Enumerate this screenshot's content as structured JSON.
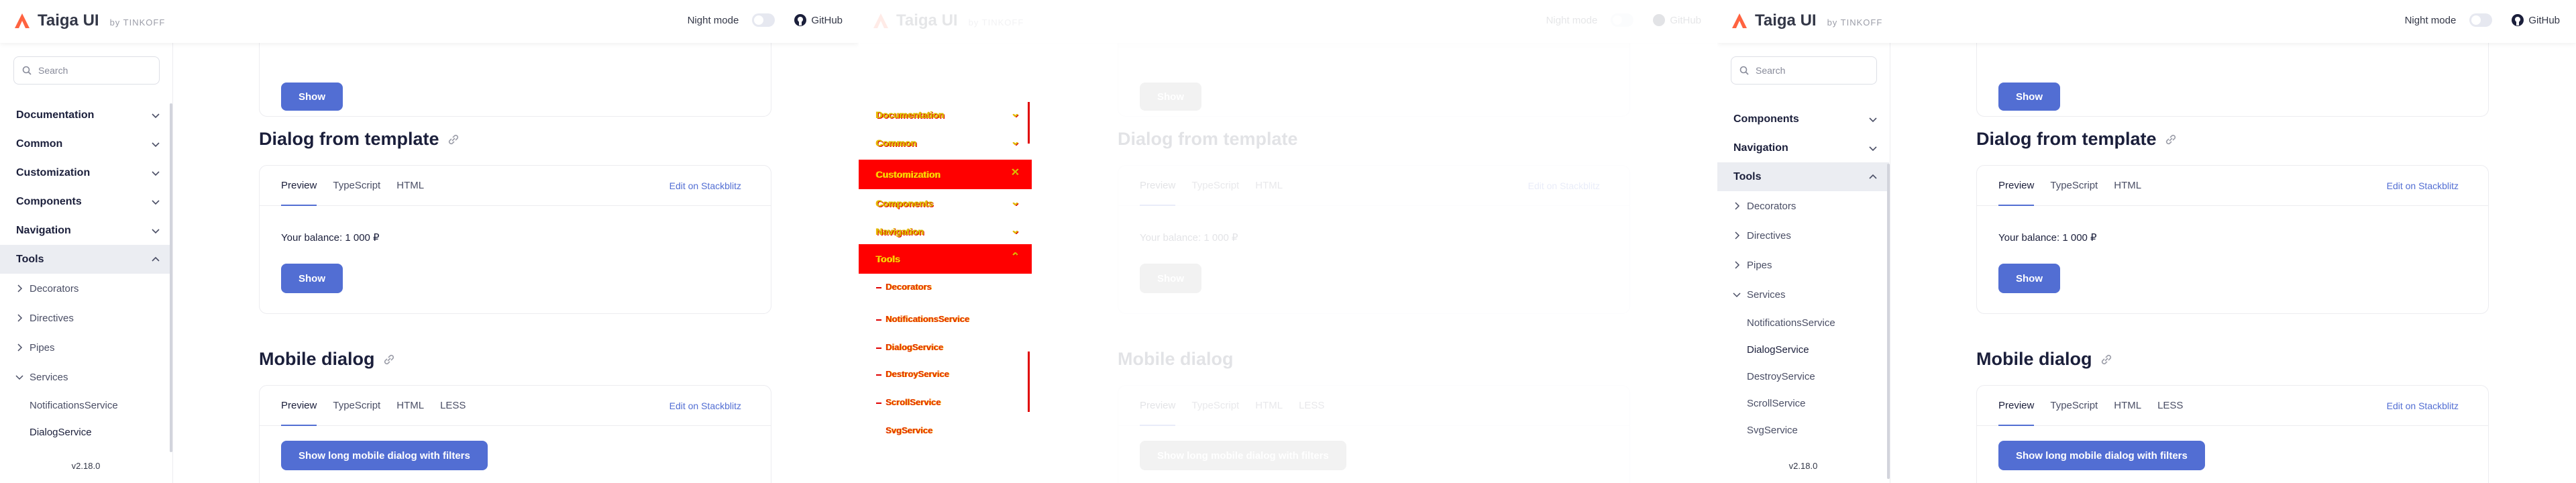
{
  "brand": {
    "title": "Taiga UI",
    "by": "by TINKOFF",
    "accent": "#526ed3",
    "logo_color": "#ff6340"
  },
  "header": {
    "night_mode": "Night mode",
    "github": "GitHub"
  },
  "search": {
    "placeholder": "Search"
  },
  "sidebar_left": {
    "items": [
      {
        "label": "Documentation"
      },
      {
        "label": "Common"
      },
      {
        "label": "Customization"
      },
      {
        "label": "Components"
      },
      {
        "label": "Navigation"
      },
      {
        "label": "Tools"
      }
    ],
    "tools_children": [
      "Decorators",
      "Directives",
      "Pipes",
      "Services"
    ],
    "services_children": [
      "NotificationsService",
      "DialogService"
    ],
    "version": "v2.18.0"
  },
  "sidebar_right": {
    "items": [
      {
        "label": "Components"
      },
      {
        "label": "Navigation"
      },
      {
        "label": "Tools"
      }
    ],
    "tools_children": [
      "Decorators",
      "Directives",
      "Pipes",
      "Services"
    ],
    "services_children": [
      "NotificationsService",
      "DialogService",
      "DestroyService",
      "ScrollService",
      "SvgService"
    ],
    "version": "v2.18.0"
  },
  "content": {
    "show_label": "Show",
    "section1_title": "Dialog from template",
    "section2_title": "Mobile dialog",
    "tabs1": [
      "Preview",
      "TypeScript",
      "HTML"
    ],
    "tabs2": [
      "Preview",
      "TypeScript",
      "HTML",
      "LESS"
    ],
    "stackblitz": "Edit on Stackblitz",
    "balance": "Your balance: 1 000 ₽",
    "mobile_button": "Show long mobile dialog with filters"
  },
  "overlay": {
    "rows": [
      "Documentation",
      "Common",
      "Customization",
      "Components",
      "Navigation",
      "Tools"
    ],
    "subs": [
      "Decorators",
      "NotificationsService",
      "DialogService",
      "DestroyService",
      "ScrollService",
      "SvgService"
    ]
  }
}
